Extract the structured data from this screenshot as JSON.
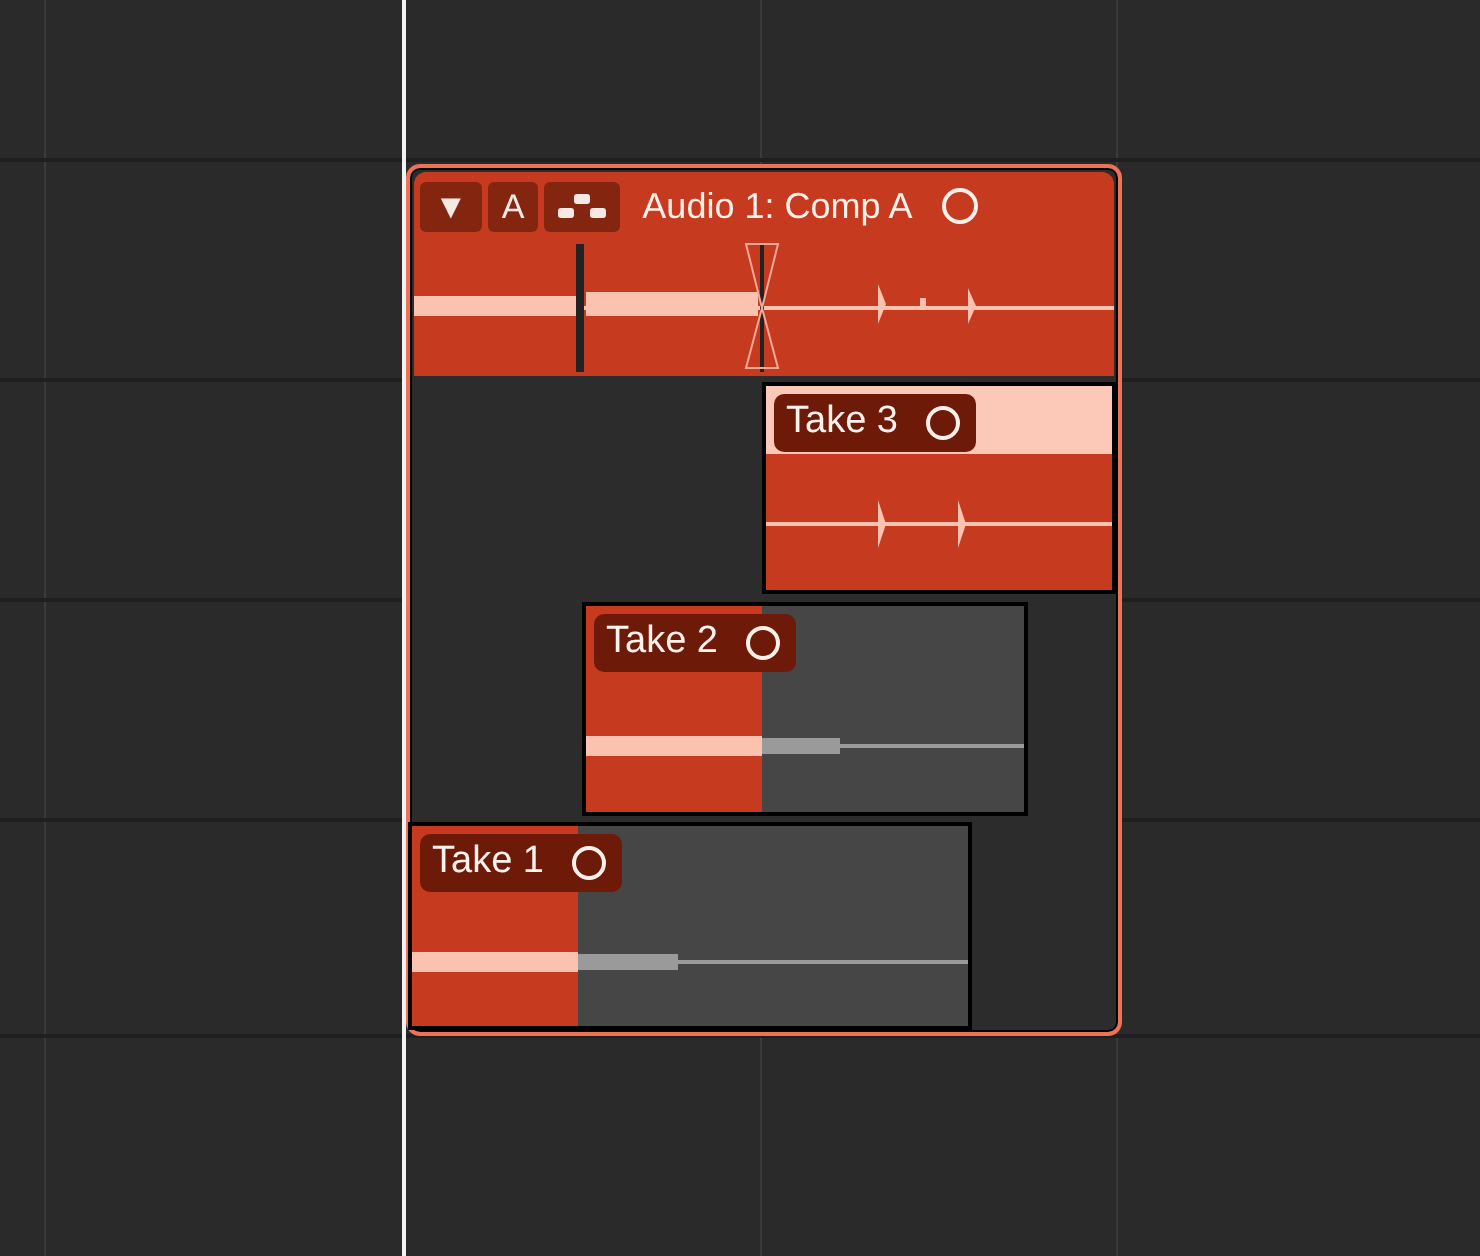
{
  "folder": {
    "collapse": "▼",
    "lane_letter": "A",
    "title": "Audio 1: Comp A"
  },
  "takes": [
    {
      "name": "Take 3",
      "selected": true
    },
    {
      "name": "Take 2",
      "selected": false
    },
    {
      "name": "Take 1",
      "selected": false
    }
  ]
}
